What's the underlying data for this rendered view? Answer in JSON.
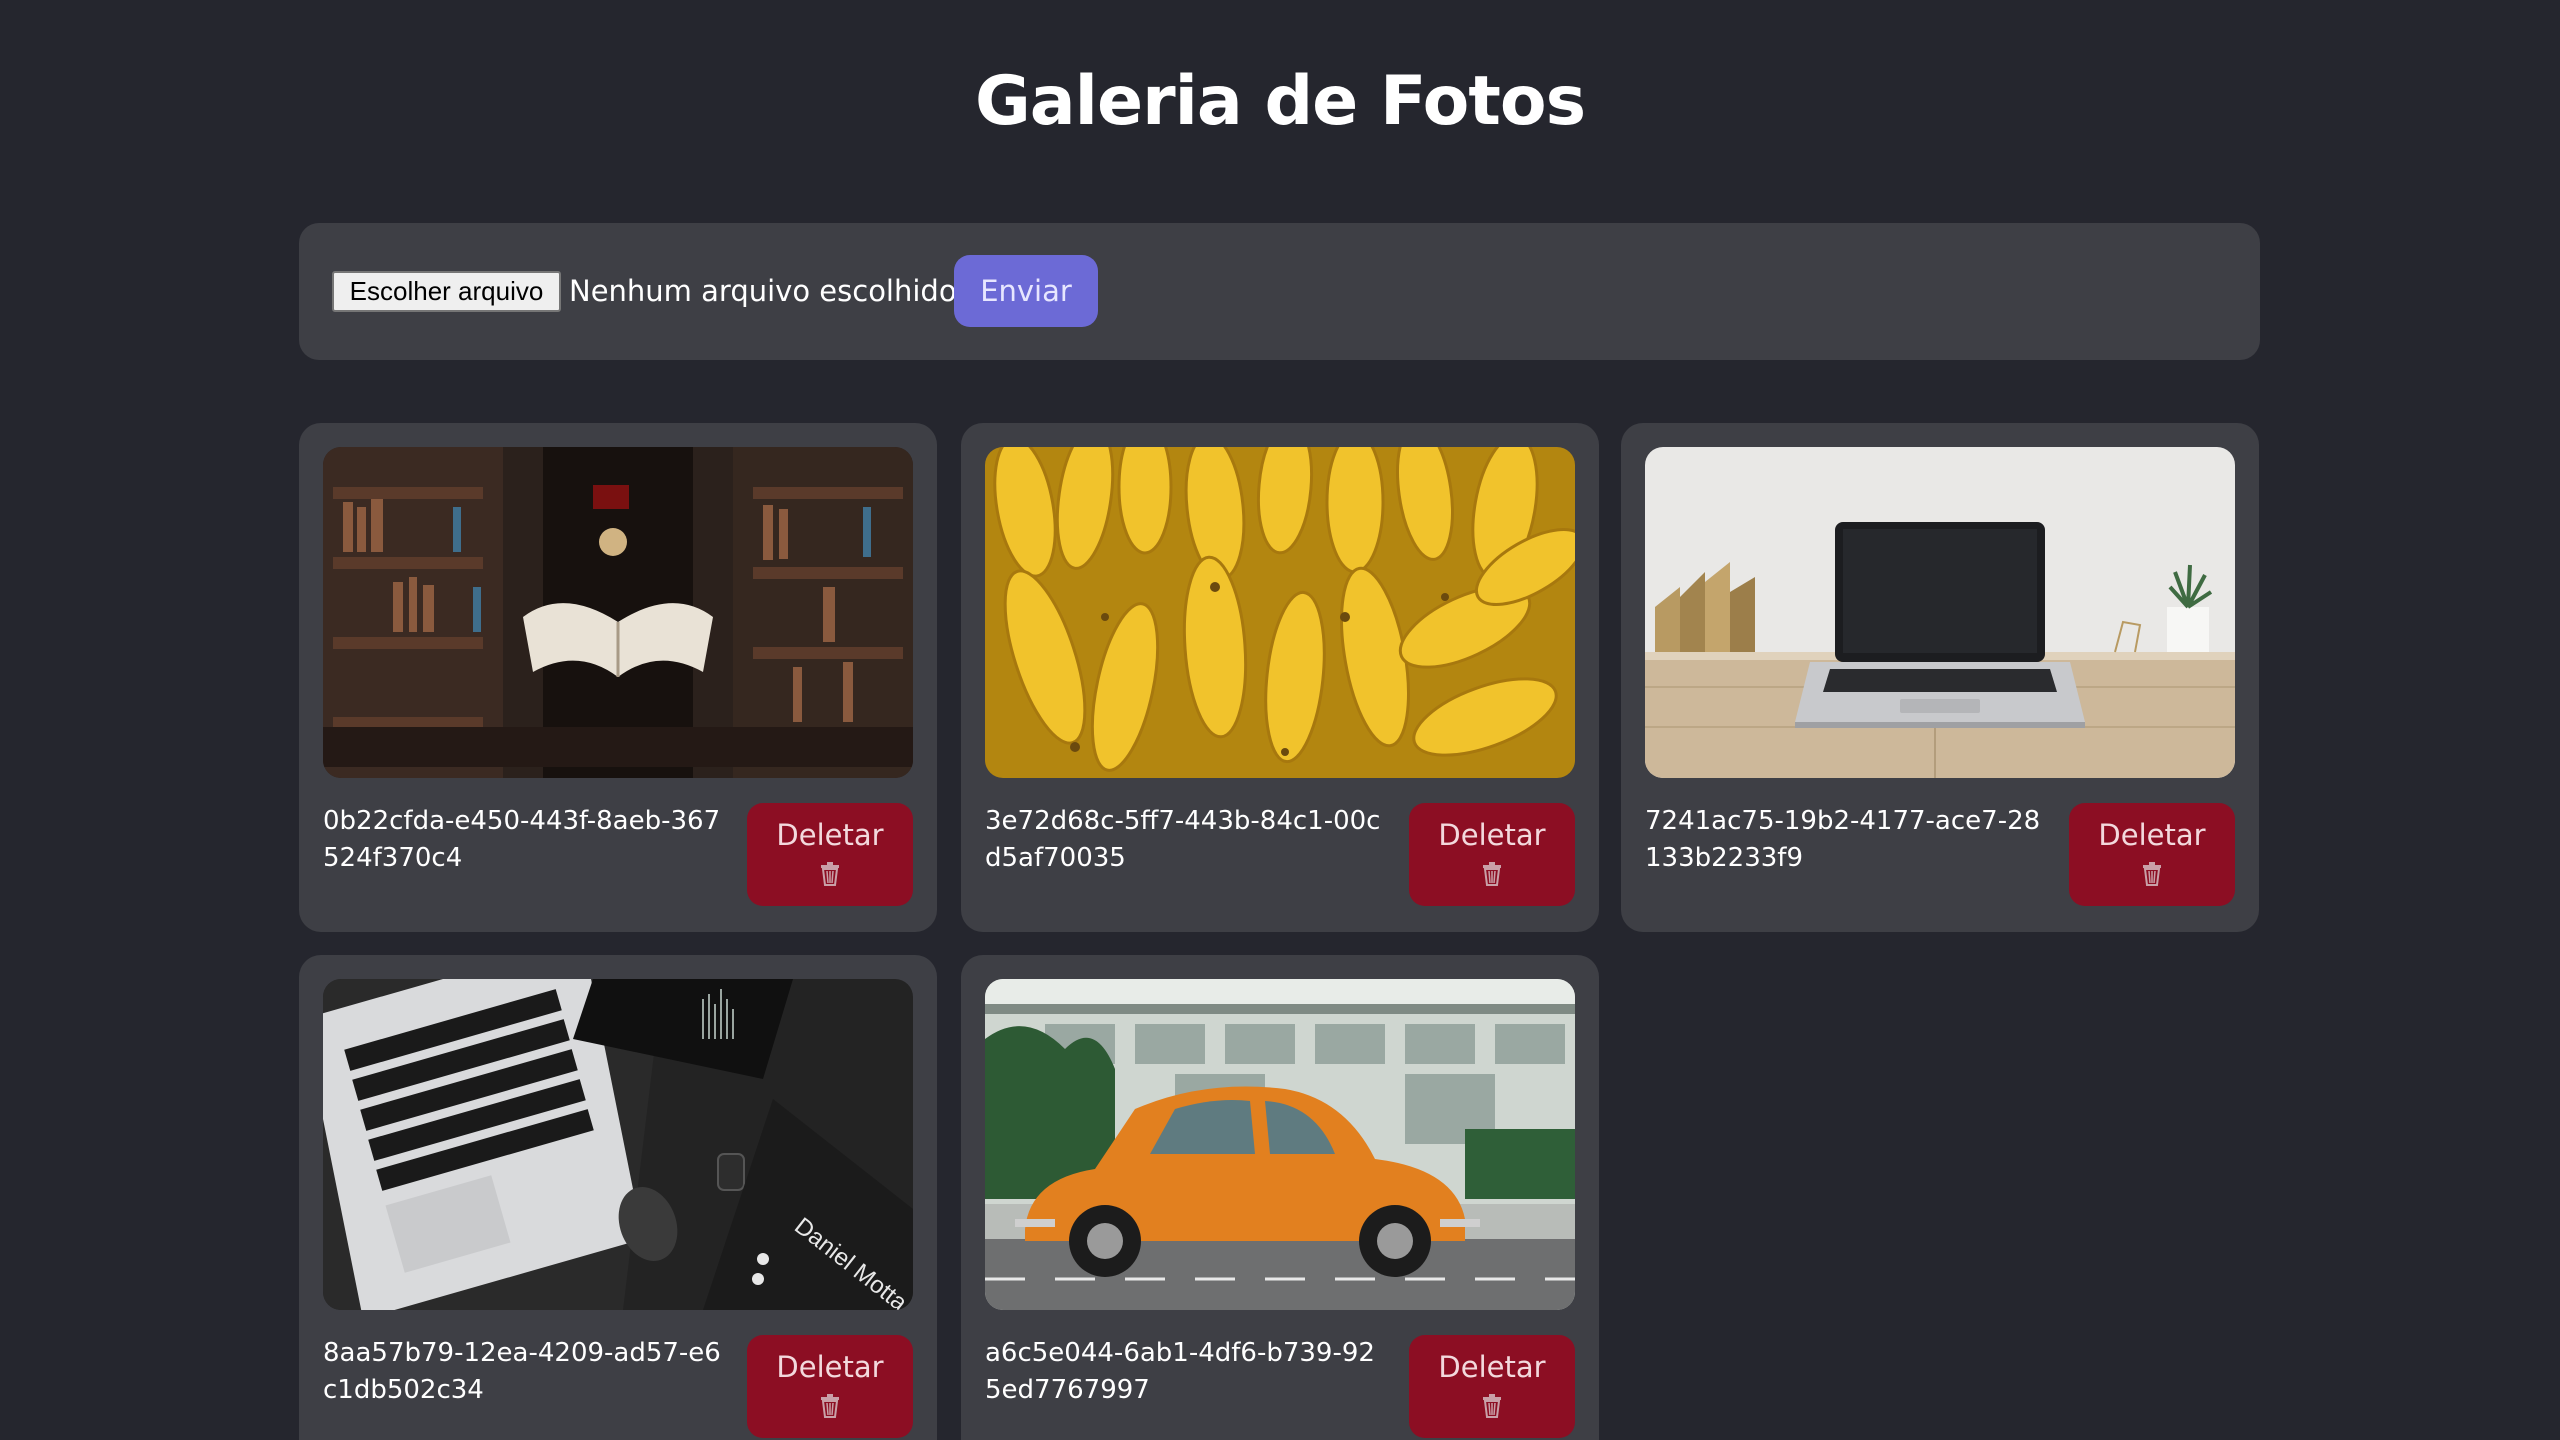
{
  "page": {
    "title": "Galeria de Fotos"
  },
  "upload": {
    "choose_file_label": "Escolher arquivo",
    "file_status": "Nenhum arquivo escolhido",
    "submit_label": "Enviar"
  },
  "photos": [
    {
      "name": "0b22cfda-e450-443f-8aeb-367524f370c4",
      "subject": "library-flying-book",
      "delete_label": "Deletar"
    },
    {
      "name": "3e72d68c-5ff7-443b-84c1-00cd5af70035",
      "subject": "bananas",
      "delete_label": "Deletar"
    },
    {
      "name": "7241ac75-19b2-4177-ace7-28133b2233f9",
      "subject": "laptop-on-desk",
      "delete_label": "Deletar"
    },
    {
      "name": "8aa57b79-12ea-4209-ad57-e6c1db502c34",
      "subject": "laptop-keyboard-card",
      "card_text": "Daniel Motta",
      "delete_label": "Deletar"
    },
    {
      "name": "a6c5e044-6ab1-4df6-b739-925ed7767997",
      "subject": "orange-beetle-car",
      "delete_label": "Deletar"
    }
  ],
  "icons": {
    "delete": "trash-icon"
  },
  "colors": {
    "background": "#25262e",
    "panel": "#3e3f45",
    "accent": "#6c6ad6",
    "danger": "#8c0e23"
  }
}
